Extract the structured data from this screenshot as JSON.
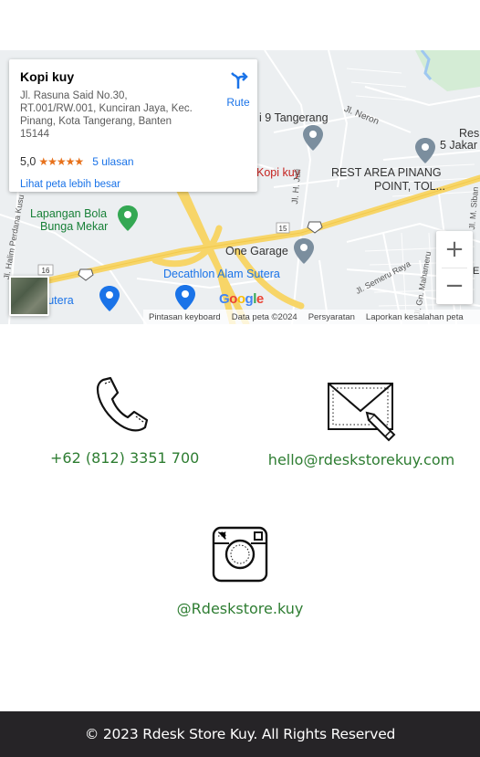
{
  "map": {
    "place": {
      "name": "Kopi kuy",
      "address": "Jl. Rasuna Said No.30, RT.001/RW.001, Kunciran Jaya, Kec. Pinang, Kota Tangerang, Banten 15144",
      "rating": "5,0",
      "stars": "★★★★★",
      "reviews": "5 ulasan",
      "view_larger": "Lihat peta lebih besar",
      "route_label": "Rute"
    },
    "labels": {
      "tangerang_school": "i 9 Tangerang",
      "jl_neron": "Jl. Neron",
      "rest_area_1": "Res",
      "rest_area_2": "5 Jakar",
      "kopi_kuy": "Kopi kuy",
      "rest_area_pinang_1": "REST AREA PINANG",
      "rest_area_pinang_2": "POINT, TOL...",
      "jl_h_jali": "Jl. H. Jali",
      "jl_halim": "Jl. Halim Perdana Kusu",
      "lapangan_1": "Lapangan Bola",
      "lapangan_2": "Bunga Mekar",
      "road_15": "15",
      "road_16": "16",
      "one_garage": "One Garage",
      "jl_semeru": "Jl. Semeru Raya",
      "jl_gn_mahameru": "Jl. Gn. Mahameru",
      "decathlon": "Decathlon Alam Sutera",
      "alam_sutera": "m Sutera",
      "alam_sutera_k": "K",
      "jl_m_siban": "Jl. M. Siban",
      "edge_e": "E"
    },
    "google_letters": [
      "G",
      "o",
      "o",
      "g",
      "l",
      "e"
    ],
    "google_colors": [
      "#4285f4",
      "#ea4335",
      "#fbbc05",
      "#4285f4",
      "#34a853",
      "#ea4335"
    ],
    "zoom_in": "+",
    "zoom_out": "−",
    "attribution": {
      "shortcuts": "Pintasan keyboard",
      "data": "Data peta ©2024",
      "terms": "Persyaratan",
      "report": "Laporkan kesalahan peta"
    }
  },
  "contact": {
    "phone": "+62 (812) 3351 700",
    "email": "hello@rdeskstorekuy.com",
    "instagram": "@Rdeskstore.kuy",
    "text_color": "#2e7d32"
  },
  "footer": {
    "copyright": "© 2023 Rdesk Store Kuy. All Rights Reserved",
    "background": "#262427"
  }
}
